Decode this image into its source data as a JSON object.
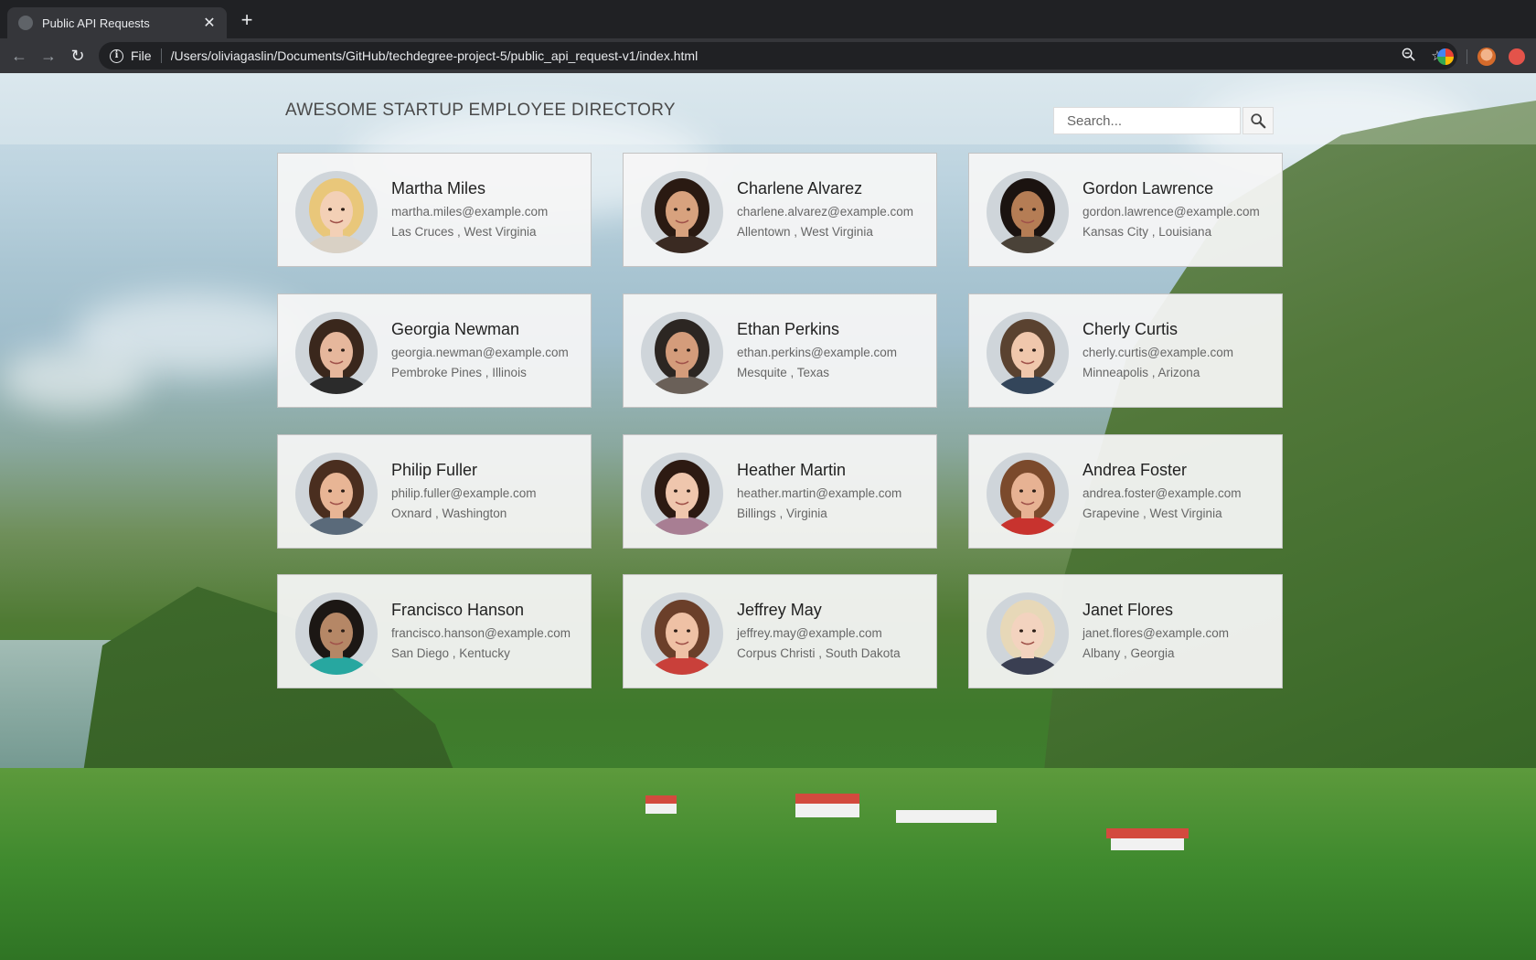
{
  "browser": {
    "tab_title": "Public API Requests",
    "url_scheme": "File",
    "url": "/Users/oliviagaslin/Documents/GitHub/techdegree-project-5/public_api_request-v1/index.html"
  },
  "header": {
    "title": "AWESOME STARTUP EMPLOYEE DIRECTORY",
    "search_placeholder": "Search..."
  },
  "employees": [
    {
      "name": "Martha Miles",
      "email": "martha.miles@example.com",
      "location": "Las Cruces , West Virginia",
      "skin": "#f3d0b6",
      "hair": "#e9c77a",
      "shirt": "#d9d1c5"
    },
    {
      "name": "Charlene Alvarez",
      "email": "charlene.alvarez@example.com",
      "location": "Allentown , West Virginia",
      "skin": "#d8a27e",
      "hair": "#2a1a12",
      "shirt": "#3a2a22"
    },
    {
      "name": "Gordon Lawrence",
      "email": "gordon.lawrence@example.com",
      "location": "Kansas City , Louisiana",
      "skin": "#b57d55",
      "hair": "#1b1310",
      "shirt": "#4a4238"
    },
    {
      "name": "Georgia Newman",
      "email": "georgia.newman@example.com",
      "location": "Pembroke Pines , Illinois",
      "skin": "#e6b79c",
      "hair": "#3a271c",
      "shirt": "#2b2b2b"
    },
    {
      "name": "Ethan Perkins",
      "email": "ethan.perkins@example.com",
      "location": "Mesquite , Texas",
      "skin": "#d49c7b",
      "hair": "#2c2622",
      "shirt": "#6a6058"
    },
    {
      "name": "Cherly Curtis",
      "email": "cherly.curtis@example.com",
      "location": "Minneapolis , Arizona",
      "skin": "#f0c7ac",
      "hair": "#5a4230",
      "shirt": "#33455a"
    },
    {
      "name": "Philip Fuller",
      "email": "philip.fuller@example.com",
      "location": "Oxnard , Washington",
      "skin": "#e8b595",
      "hair": "#4a2e1f",
      "shirt": "#5a6a7a"
    },
    {
      "name": "Heather Martin",
      "email": "heather.martin@example.com",
      "location": "Billings , Virginia",
      "skin": "#efc6ad",
      "hair": "#2d1a12",
      "shirt": "#a87e93"
    },
    {
      "name": "Andrea Foster",
      "email": "andrea.foster@example.com",
      "location": "Grapevine , West Virginia",
      "skin": "#e7b293",
      "hair": "#7b4a2c",
      "shirt": "#c8332e"
    },
    {
      "name": "Francisco Hanson",
      "email": "francisco.hanson@example.com",
      "location": "San Diego , Kentucky",
      "skin": "#b58766",
      "hair": "#1c1714",
      "shirt": "#27a7a0"
    },
    {
      "name": "Jeffrey May",
      "email": "jeffrey.may@example.com",
      "location": "Corpus Christi , South Dakota",
      "skin": "#efc1a5",
      "hair": "#6b3f2a",
      "shirt": "#c9403a"
    },
    {
      "name": "Janet Flores",
      "email": "janet.flores@example.com",
      "location": "Albany , Georgia",
      "skin": "#f3d3bf",
      "hair": "#e7d8b8",
      "shirt": "#3a3f52"
    }
  ]
}
